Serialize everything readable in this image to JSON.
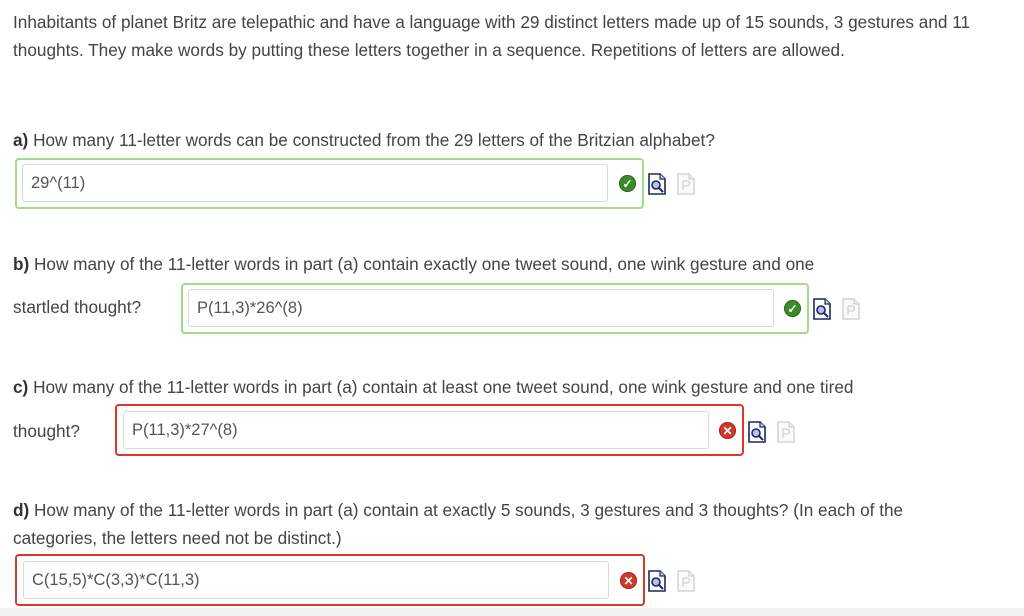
{
  "intro": "Inhabitants of planet Britz are telepathic and have a language with 29 distinct letters made up of 15 sounds, 3 gestures and 11 thoughts.  They make words by putting these letters together in a sequence.  Repetitions of letters are allowed.",
  "questions": [
    {
      "prefix": "a)",
      "text": " How many 11-letter words can be constructed from the 29 letters of the Britzian alphabet?",
      "trailing": "",
      "answer": "29^(11)",
      "status": "correct",
      "status_icon": "check-icon"
    },
    {
      "prefix": "b)",
      "text": " How many of the 11-letter words in part (a) contain exactly one tweet sound, one wink gesture and one",
      "trailing": "startled thought?",
      "answer": "P(11,3)*26^(8)",
      "status": "correct",
      "status_icon": "check-icon"
    },
    {
      "prefix": "c)",
      "text": " How many of the 11-letter words in part (a) contain at least one tweet sound, one wink gesture and one tired",
      "trailing": "thought?",
      "answer": "P(11,3)*27^(8)",
      "status": "incorrect",
      "status_icon": "x-icon"
    },
    {
      "prefix": "d)",
      "text": " How many of the 11-letter words in part (a) contain at exactly 5 sounds, 3 gestures and 3 thoughts?  (In each of the categories, the letters need not be distinct.)",
      "trailing": "",
      "answer": "C(15,5)*C(3,3)*C(11,3)",
      "status": "incorrect",
      "status_icon": "x-icon"
    }
  ],
  "icons": {
    "preview": "preview-icon",
    "page": "page-icon"
  },
  "colors": {
    "correct_border": "#9fdd8b",
    "incorrect_border": "#d7392a",
    "correct_badge": "#3d8a2e",
    "incorrect_badge": "#cc3a2e"
  }
}
